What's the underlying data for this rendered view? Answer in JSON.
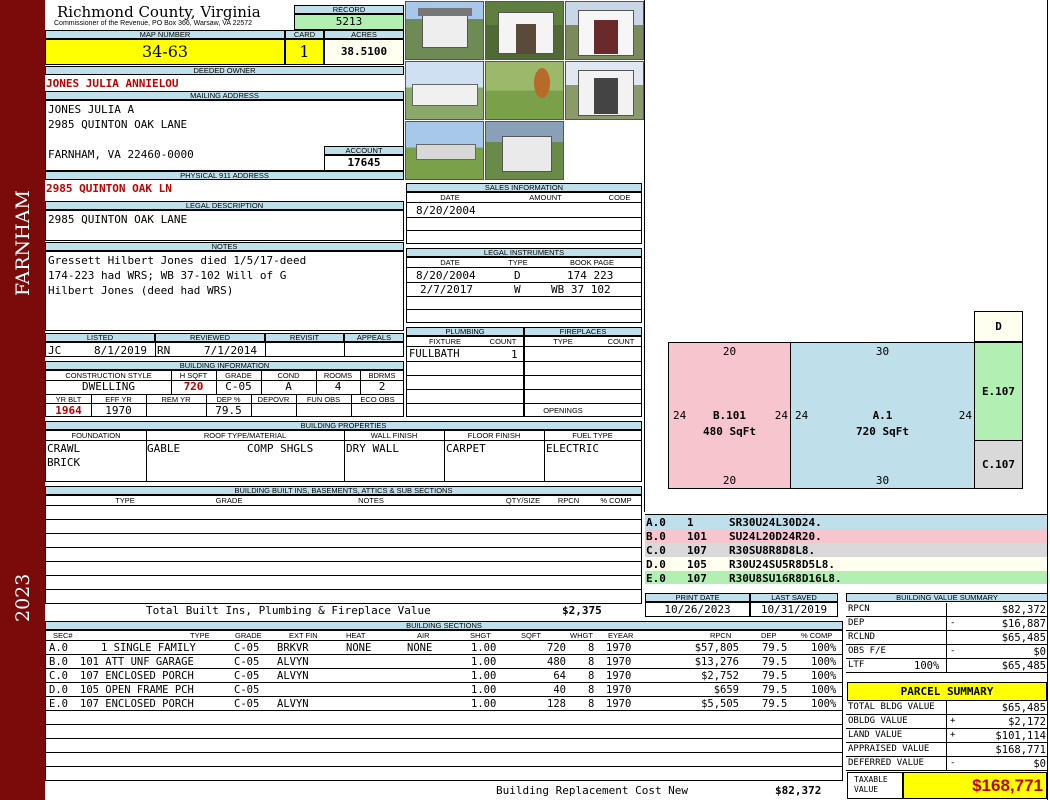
{
  "side": {
    "city": "FARNHAM",
    "year": "2023"
  },
  "header": {
    "county": "Richmond County, Virginia",
    "commissioner": "Commissioner of the Revenue, PO Box 366, Warsaw, VA 22572",
    "record_label": "RECORD",
    "record": "5213",
    "map_label": "MAP NUMBER",
    "map_number": "34-63",
    "card_label": "CARD",
    "card": "1",
    "acres_label": "ACRES",
    "acres": "38.5100"
  },
  "owner": {
    "deeded_label": "DEEDED OWNER",
    "deeded_owner": "JONES JULIA ANNIELOU",
    "mailing_label": "MAILING ADDRESS",
    "mailing_line1": "JONES JULIA A",
    "mailing_line2": "2985 QUINTON OAK LANE",
    "mailing_line3": "FARNHAM, VA 22460-0000",
    "account_label": "ACCOUNT",
    "account": "17645",
    "physical_label": "PHYSICAL 911 ADDRESS",
    "physical": "2985 QUINTON OAK LN",
    "legal_label": "LEGAL DESCRIPTION",
    "legal": "2985 QUINTON OAK LANE",
    "notes_label": "NOTES",
    "notes_line1": "Gressett Hilbert Jones died 1/5/17-deed",
    "notes_line2": "174-223 had WRS; WB 37-102 Will of G",
    "notes_line3": "Hilbert Jones (deed had WRS)"
  },
  "listing": {
    "listed_label": "LISTED",
    "reviewed_label": "REVIEWED",
    "revisit_label": "REVISIT",
    "appeals_label": "APPEALS",
    "listed_by": "JC",
    "listed_date": "8/1/2019",
    "reviewed_by": "RN",
    "reviewed_date": "7/1/2014"
  },
  "building": {
    "title": "BUILDING INFORMATION",
    "style_label": "CONSTRUCTION STYLE",
    "hsqft_label": "H SQFT",
    "grade_label": "GRADE",
    "cond_label": "COND",
    "rooms_label": "ROOMS",
    "bdrms_label": "BDRMS",
    "style": "DWELLING",
    "hsqft": "720",
    "grade": "C-05",
    "cond": "A",
    "rooms": "4",
    "bdrms": "2",
    "yrblt_label": "YR BLT",
    "effyr_label": "EFF YR",
    "remyr_label": "REM YR",
    "dep_label": "DEP %",
    "depovr_label": "DEPOVR",
    "funobs_label": "FUN OBS",
    "ecoobs_label": "ECO OBS",
    "yrblt": "1964",
    "effyr": "1970",
    "dep": "79.5"
  },
  "properties": {
    "title": "BUILDING PROPERTIES",
    "foundation_label": "FOUNDATION",
    "roof_label": "ROOF TYPE/MATERIAL",
    "wall_label": "WALL FINISH",
    "floor_label": "FLOOR FINISH",
    "fuel_label": "FUEL TYPE",
    "foundation1": "CRAWL",
    "foundation2": "BRICK",
    "roof_type": "GABLE",
    "roof_material": "COMP SHGLS",
    "wall": "DRY WALL",
    "floor": "CARPET",
    "fuel": "ELECTRIC"
  },
  "builtins": {
    "title": "BUILDING BUILT INS, BASEMENTS, ATTICS & SUB SECTIONS",
    "headers": [
      "TYPE",
      "GRADE",
      "NOTES",
      "QTY/SIZE",
      "RPCN",
      "% COMP"
    ],
    "total_label": "Total Built Ins, Plumbing & Fireplace Value",
    "total": "$2,375"
  },
  "sales": {
    "title": "SALES INFORMATION",
    "headers": [
      "DATE",
      "AMOUNT",
      "CODE"
    ],
    "rows": [
      {
        "date": "8/20/2004"
      }
    ]
  },
  "legal_instruments": {
    "title": "LEGAL INSTRUMENTS",
    "headers": [
      "DATE",
      "TYPE",
      "BOOK PAGE"
    ],
    "rows": [
      {
        "date": "8/20/2004",
        "type": "D",
        "book": "174 223"
      },
      {
        "date": "2/7/2017",
        "type": "W",
        "book": "WB 37 102"
      }
    ]
  },
  "plumbing": {
    "title": "PLUMBING",
    "fixture_label": "FIXTURE",
    "count_label": "COUNT",
    "fixture": "FULLBATH",
    "count": "1"
  },
  "fireplaces": {
    "title": "FIREPLACES",
    "type_label": "TYPE",
    "count_label": "COUNT",
    "openings_label": "OPENINGS"
  },
  "sketch": {
    "d_label": "D",
    "b_top": "20",
    "b_bottom": "20",
    "b_left": "24",
    "b_right": "24",
    "b_name": "B.101",
    "b_area": "480 SqFt",
    "a_top": "30",
    "a_bottom": "30",
    "a_left": "24",
    "a_right": "24",
    "a_name": "A.1",
    "a_area": "720 SqFt",
    "e_label": "E.107",
    "c_label": "C.107"
  },
  "sketch_legend": [
    {
      "sec": "A.0",
      "code": "1",
      "vectors": "SR30U24L30D24.",
      "color": "#bfe0ea"
    },
    {
      "sec": "B.0",
      "code": "101",
      "vectors": "SU24L20D24R20.",
      "color": "#f7c5ce"
    },
    {
      "sec": "C.0",
      "code": "107",
      "vectors": "R30SU8R8D8L8.",
      "color": "#d9d9d9"
    },
    {
      "sec": "D.0",
      "code": "105",
      "vectors": "R30U24SU5R8D5L8.",
      "color": "#fffff0"
    },
    {
      "sec": "E.0",
      "code": "107",
      "vectors": "R30U8SU16R8D16L8.",
      "color": "#b2efb2"
    }
  ],
  "dates": {
    "print_label": "PRINT DATE",
    "print": "10/26/2023",
    "saved_label": "LAST SAVED",
    "saved": "10/31/2019"
  },
  "building_value": {
    "title": "BUILDING VALUE SUMMARY",
    "rows": [
      {
        "label": "RPCN",
        "sign": "",
        "value": "$82,372"
      },
      {
        "label": "DEP",
        "sign": "-",
        "value": "$16,887"
      },
      {
        "label": "RCLND",
        "sign": "",
        "value": "$65,485"
      },
      {
        "label": "OBS F/E",
        "sign": "-",
        "value": "$0"
      },
      {
        "label": "LTF",
        "pct": "100%",
        "sign": "",
        "value": "$65,485"
      }
    ]
  },
  "parcel": {
    "title": "PARCEL SUMMARY",
    "rows": [
      {
        "label": "TOTAL BLDG VALUE",
        "sign": "",
        "value": "$65,485"
      },
      {
        "label": "OBLDG VALUE",
        "sign": "+",
        "value": "$2,172"
      },
      {
        "label": "LAND VALUE",
        "sign": "+",
        "value": "$101,114"
      },
      {
        "label": "APPRAISED VALUE",
        "sign": "",
        "value": "$168,771"
      },
      {
        "label": "DEFERRED VALUE",
        "sign": "-",
        "value": "$0"
      }
    ],
    "taxable_label": "TAXABLE VALUE",
    "taxable": "$168,771"
  },
  "sections": {
    "title": "BUILDING SECTIONS",
    "headers": [
      "SEC#",
      "TYPE",
      "GRADE",
      "EXT FIN",
      "HEAT",
      "AIR",
      "SHGT",
      "SQFT",
      "WHGT",
      "EYEAR",
      "RPCN",
      "DEP",
      "% COMP"
    ],
    "rows": [
      [
        "A.0",
        "1 SINGLE FAMILY",
        "C-05",
        "BRKVR",
        "NONE",
        "NONE",
        "1.00",
        "720",
        "8",
        "1970",
        "$57,805",
        "79.5",
        "100%"
      ],
      [
        "B.0",
        "101 ATT UNF GARAGE",
        "C-05",
        "ALVYN",
        "",
        "",
        "1.00",
        "480",
        "8",
        "1970",
        "$13,276",
        "79.5",
        "100%"
      ],
      [
        "C.0",
        "107 ENCLOSED PORCH",
        "C-05",
        "ALVYN",
        "",
        "",
        "1.00",
        "64",
        "8",
        "1970",
        "$2,752",
        "79.5",
        "100%"
      ],
      [
        "D.0",
        "105 OPEN FRAME PCH",
        "C-05",
        "",
        "",
        "",
        "1.00",
        "40",
        "8",
        "1970",
        "$659",
        "79.5",
        "100%"
      ],
      [
        "E.0",
        "107 ENCLOSED PORCH",
        "C-05",
        "ALVYN",
        "",
        "",
        "1.00",
        "128",
        "8",
        "1970",
        "$5,505",
        "79.5",
        "100%"
      ]
    ],
    "replacement_label": "Building Replacement Cost New",
    "replacement": "$82,372"
  }
}
